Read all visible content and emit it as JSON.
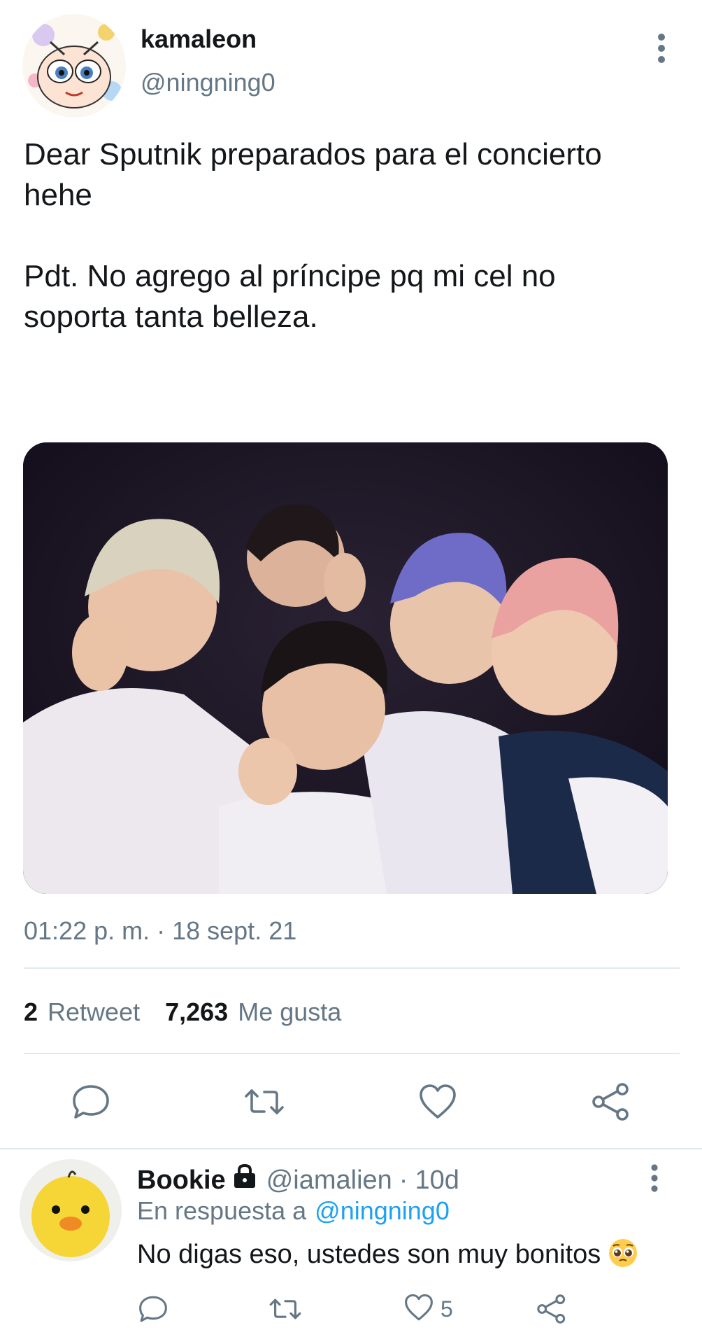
{
  "tweet": {
    "author": {
      "name": "kamaleon",
      "handle": "@ningning0"
    },
    "text": "Dear Sputnik preparados para el concierto\nhehe\n\nPdt. No agrego al príncipe pq mi cel no\nsoporta tanta belleza.",
    "timestamp": "01:22 p. m. · 18 sept. 21",
    "stats": {
      "retweets_count": "2",
      "retweets_label": "Retweet",
      "likes_count": "7,263",
      "likes_label": "Me gusta"
    },
    "actions": [
      "reply-icon",
      "retweet-icon",
      "like-icon",
      "share-icon"
    ]
  },
  "reply": {
    "author": {
      "name": "Bookie",
      "handle": "@iamalien",
      "time": "10d"
    },
    "separator": "·",
    "in_reply_to_label": "En respuesta a",
    "in_reply_to_handle": "@ningning0",
    "text": "No digas eso, ustedes son muy bonitos",
    "emoji": "pleading-face-emoji",
    "likes_count": "5",
    "protected_icon": "lock-icon"
  },
  "colors": {
    "text_primary": "#14171a",
    "text_secondary": "#657786",
    "link": "#1da1f2",
    "divider": "#e1e8ed",
    "icon": "#657786"
  }
}
